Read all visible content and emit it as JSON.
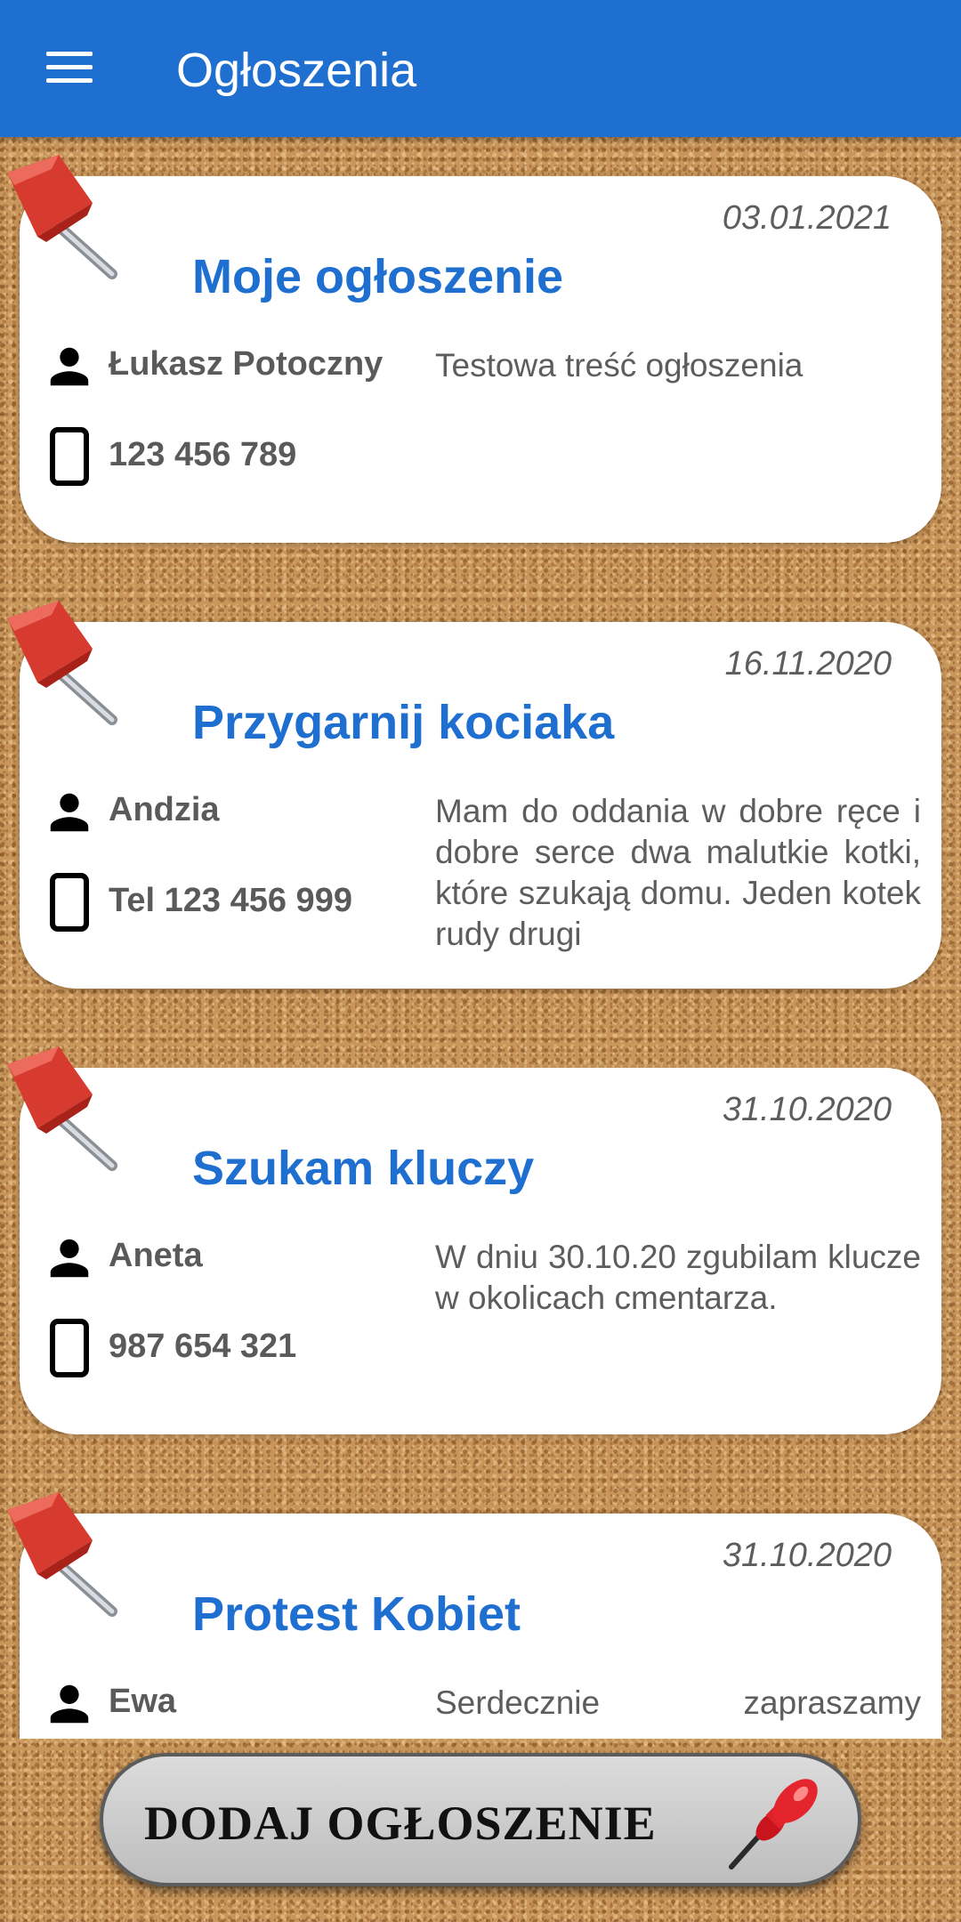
{
  "app_bar": {
    "title": "Ogłoszenia",
    "menu_icon": "hamburger-menu-icon",
    "background": "#1e6fd0"
  },
  "announcements": [
    {
      "date": "03.01.2021",
      "title": "Moje ogłoszenie",
      "author": "Łukasz Potoczny",
      "phone": "123 456 789",
      "content": "Testowa treść ogłoszenia"
    },
    {
      "date": "16.11.2020",
      "title": "Przygarnij kociaka",
      "author": "Andzia",
      "phone": "Tel 123 456 999",
      "content": "Mam do oddania w dobre ręce i dobre serce dwa malutkie kotki, które szukają domu. Jeden kotek rudy drugi"
    },
    {
      "date": "31.10.2020",
      "title": "Szukam kluczy",
      "author": "Aneta",
      "phone": "987 654 321",
      "content": "W dniu 30.10.20 zgubilam klucze w okolicach cmentarza."
    },
    {
      "date": "31.10.2020",
      "title": "Protest Kobiet",
      "author": "Ewa",
      "phone": "",
      "content": "Serdecznie zapraszamy"
    }
  ],
  "add_button": {
    "label": "DODAJ OGŁOSZENIE",
    "icon": "pushpin-icon"
  }
}
